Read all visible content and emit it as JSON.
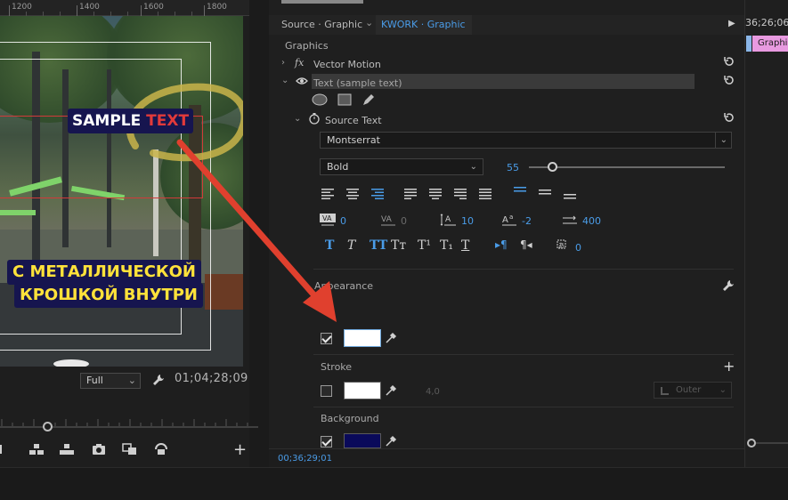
{
  "monitor": {
    "ruler_labels": [
      "1200",
      "1400",
      "1600",
      "1800"
    ],
    "overlay": {
      "title_word1": "SAMPLE ",
      "title_word2": "TEXT",
      "caption_line1": "С МЕТАЛЛИЧЕСКОЙ",
      "caption_line2": "КРОШКОЙ ВНУТРИ"
    },
    "zoom": "Full",
    "timecode": "01;04;28;09",
    "transport_icons": [
      "marker-icon",
      "lift-icon",
      "extract-icon",
      "export-frame-camera-icon",
      "comparison-view-icon",
      "vr-icon"
    ]
  },
  "tabs": {
    "source": "Source · Graphic",
    "active": "KWORK · Graphic"
  },
  "panel": {
    "section": "Graphics",
    "vector_motion": "Vector Motion",
    "layer": "Text (sample text)",
    "source_text": "Source Text",
    "font": "Montserrat",
    "font_style": "Bold",
    "font_size": "55",
    "font_size_fraction": 0.12,
    "kerning": "0",
    "tracking": "0",
    "leading": "10",
    "baseline_shift": "-2",
    "tab_width": "400",
    "tsume": "0",
    "appearance": "Appearance",
    "fill_color": "#ffffff",
    "stroke": "Stroke",
    "stroke_color": "#ffffff",
    "stroke_width": "4,0",
    "stroke_position": "Outer",
    "background": "Background",
    "background_color": "#0a0a5a",
    "timecode": "00;36;29;01"
  },
  "timeline": {
    "timecode": "36;26;06",
    "clip": "Graphic"
  },
  "colors": {
    "accent_blue": "#4a9ce8",
    "arrow_red": "#e0402e",
    "clip_pink": "#e89ae0"
  }
}
